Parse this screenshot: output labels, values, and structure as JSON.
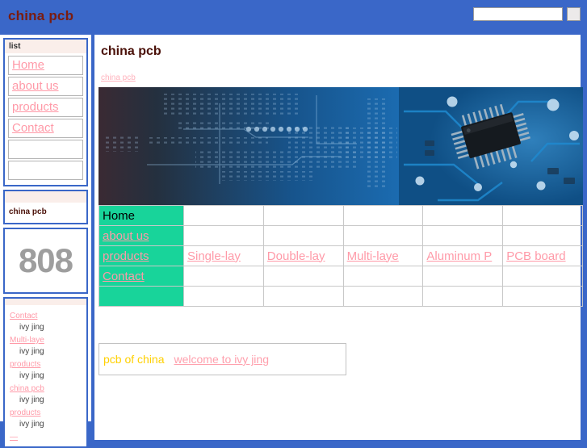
{
  "header": {
    "site_title": "china pcb",
    "search_placeholder": "",
    "search_value": "",
    "search_button_label": "",
    "accent_color": "#3a67c8",
    "title_color": "#7a1c10"
  },
  "sidebar": {
    "list_panel": {
      "heading": "list",
      "items": [
        {
          "label": "Home"
        },
        {
          "label": "about us"
        },
        {
          "label": "products"
        },
        {
          "label": "Contact"
        },
        {
          "label": ""
        },
        {
          "label": ""
        }
      ]
    },
    "brand_panel": {
      "heading": "",
      "text": "china pcb"
    },
    "counter_panel": {
      "value": "808",
      "color": "#9e9e9e"
    },
    "links_panel": {
      "heading": "",
      "author_label": "ivy jing",
      "items": [
        {
          "label": "Contact",
          "author": "ivy jing"
        },
        {
          "label": "Multi-laye",
          "author": "ivy jing"
        },
        {
          "label": "products",
          "author": "ivy jing"
        },
        {
          "label": "china pcb",
          "author": "ivy jing"
        },
        {
          "label": "products",
          "author": "ivy jing"
        }
      ],
      "tail_label": "—"
    }
  },
  "content": {
    "page_title": "china pcb",
    "breadcrumb": "china pcb",
    "banner_alt": "pcb-circuit-board-banner",
    "nav_table": {
      "menu_column": [
        {
          "label": "Home",
          "is_link": false
        },
        {
          "label": "about us",
          "is_link": true
        },
        {
          "label": "products",
          "is_link": true
        },
        {
          "label": "Contact",
          "is_link": true
        },
        {
          "label": "",
          "is_link": false
        }
      ],
      "product_row_index": 2,
      "products": [
        "Single-lay",
        "Double-lay",
        "Multi-laye",
        "Aluminum P",
        "PCB board"
      ]
    },
    "note": {
      "lead": "pcb of china",
      "link": "welcome to ivy jing",
      "lead_color": "#ffd000",
      "link_color": "#ffa0ad"
    }
  }
}
